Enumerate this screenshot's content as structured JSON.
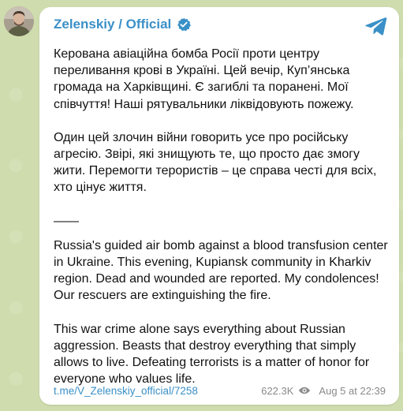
{
  "channel": {
    "name": "Zelenskiy / Official",
    "verified_icon": "verified-badge-icon",
    "avatar_icon": "channel-avatar"
  },
  "colors": {
    "accent": "#3a90c7",
    "background": "#cfdcae",
    "text": "#111111",
    "meta": "#8a8a8a"
  },
  "message": {
    "paragraphs_ua": [
      "Керована авіаційна бомба Росії проти центру переливання крові в Україні. Цей вечір, Куп’янська громада на Харківщині. Є загиблі та поранені. Мої співчуття! Наші рятувальники ліквідовують пожежу.",
      "Один цей злочин війни говорить усе про російську агресію. Звірі, які знищують те, що просто дає змогу жити. Перемогти терористів – це справа честі для всіх, хто цінує життя."
    ],
    "separator": "——",
    "paragraphs_en": [
      "Russia's guided air bomb against a blood transfusion center in Ukraine. This evening, Kupiansk community in Kharkiv region. Dead and wounded are reported. My condolences! Our rescuers are extinguishing the fire.",
      "This war crime alone says everything about Russian aggression. Beasts that destroy everything that simply allows to live. Defeating terrorists is a matter of honor for everyone who values life."
    ]
  },
  "footer": {
    "link": "t.me/V_Zelenskiy_official/7258",
    "views": "622.3K",
    "views_icon": "eye-icon",
    "time": "Aug 5 at 22:39"
  },
  "brand_icon": "telegram-logo-icon"
}
